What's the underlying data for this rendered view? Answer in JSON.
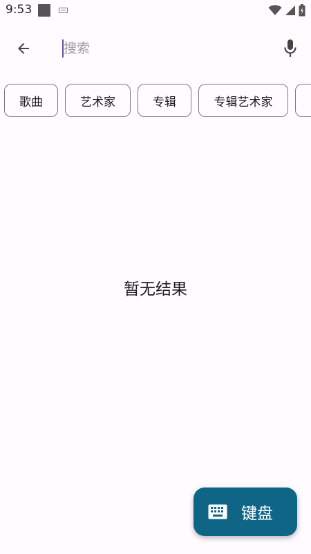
{
  "status_bar": {
    "time": "9:53",
    "icons": [
      "notification-square-icon",
      "keyboard-icon",
      "wifi-icon",
      "cellular-signal-icon",
      "battery-icon"
    ]
  },
  "search": {
    "placeholder": "搜索",
    "value": "",
    "back_icon": "arrow-back-icon",
    "mic_icon": "microphone-icon"
  },
  "filters": {
    "chips": [
      {
        "label": "歌曲"
      },
      {
        "label": "艺术家"
      },
      {
        "label": "专辑"
      },
      {
        "label": "专辑艺术家"
      },
      {
        "label": ""
      }
    ]
  },
  "results": {
    "empty_message": "暂无结果"
  },
  "fab": {
    "label": "键盘",
    "icon": "keyboard-icon",
    "color": "#0e6586"
  },
  "colors": {
    "background": "#fffbfe",
    "text": "#1d1b20",
    "chip_border": "#7a757f",
    "accent": "#0e6586"
  }
}
